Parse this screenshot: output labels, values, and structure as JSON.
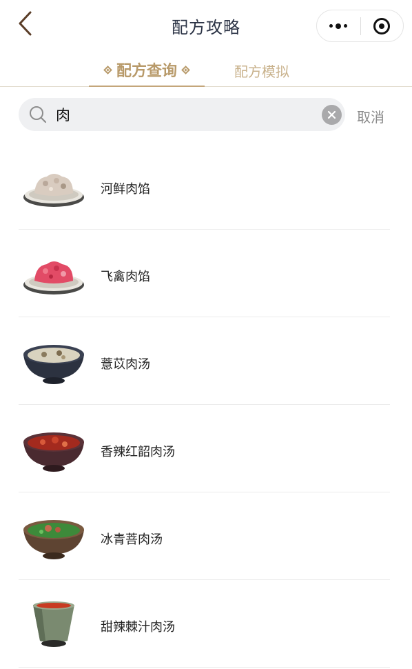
{
  "nav": {
    "title": "配方攻略",
    "back_icon": "chevron-left-icon",
    "more_icon": "more-dots-icon",
    "close_icon": "capsule-close-icon"
  },
  "tabs": [
    {
      "label": "配方查询",
      "active": true
    },
    {
      "label": "配方模拟",
      "active": false
    }
  ],
  "search": {
    "value": "肉",
    "placeholder": "",
    "cancel_label": "取消"
  },
  "colors": {
    "accent": "#b89a6a",
    "accent_light": "#c9b28c",
    "title": "#2b3345",
    "search_bg": "#eff0f2"
  },
  "results": [
    {
      "name": "河鲜肉馅",
      "dish": "plate",
      "food_color": "#d9ccc0"
    },
    {
      "name": "飞禽肉馅",
      "dish": "plate",
      "food_color": "#e24b66"
    },
    {
      "name": "薏苡肉汤",
      "dish": "bowl-dark",
      "food_color": "#d9d3bf"
    },
    {
      "name": "香辣红韶肉汤",
      "dish": "bowl-red",
      "food_color": "#a32a1e"
    },
    {
      "name": "冰青菩肉汤",
      "dish": "bowl-brown",
      "food_color": "#3d8a3a"
    },
    {
      "name": "甜辣棘汁肉汤",
      "dish": "cup",
      "food_color": "#c83a22"
    }
  ]
}
